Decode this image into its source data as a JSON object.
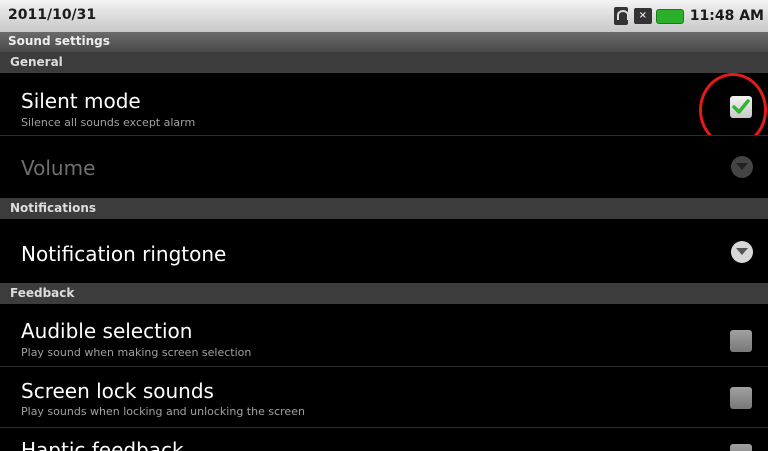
{
  "status_bar": {
    "date": "2011/10/31",
    "time": "11:48 AM",
    "icons": [
      "wifi-icon",
      "mute-icon",
      "battery-icon"
    ]
  },
  "title": "Sound settings",
  "sections": {
    "general": "General",
    "notifications": "Notifications",
    "feedback": "Feedback"
  },
  "items": {
    "silent_mode": {
      "title": "Silent mode",
      "summary": "Silence all sounds except alarm",
      "checked": true
    },
    "volume": {
      "title": "Volume",
      "enabled": false
    },
    "notification_ringtone": {
      "title": "Notification ringtone"
    },
    "audible_selection": {
      "title": "Audible selection",
      "summary": "Play sound when making screen selection",
      "checked": false
    },
    "screen_lock_sounds": {
      "title": "Screen lock sounds",
      "summary": "Play sounds when locking and unlocking the screen",
      "checked": false
    },
    "haptic_feedback": {
      "title": "Haptic feedback"
    }
  },
  "colors": {
    "highlight": "#e21b1b",
    "check": "#2db82d"
  }
}
